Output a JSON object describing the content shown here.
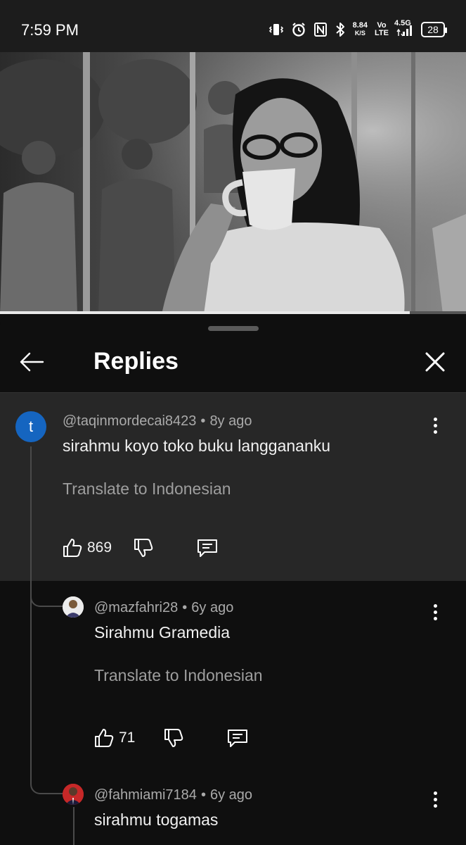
{
  "status_bar": {
    "time": "7:59 PM",
    "net_speed_value": "8.84",
    "net_speed_unit": "K/S",
    "volte_top": "Vo",
    "volte_bottom": "LTE",
    "network": "4.5G",
    "battery": "28"
  },
  "video": {
    "progress_fraction": 0.88
  },
  "header": {
    "title": "Replies"
  },
  "parent_comment": {
    "avatar_letter": "t",
    "handle": "@taqinmordecai8423",
    "time": "8y ago",
    "text": "sirahmu koyo toko buku langgananku",
    "translate": "Translate to Indonesian",
    "likes": "869"
  },
  "replies": [
    {
      "handle": "@mazfahri28",
      "time": "6y ago",
      "text": "Sirahmu Gramedia",
      "translate": "Translate to Indonesian",
      "likes": "71"
    },
    {
      "handle": "@fahmiami7184",
      "time": "6y ago",
      "text": "sirahmu togamas"
    }
  ],
  "meta_separator": "•",
  "colors": {
    "sheet_bg": "#0f0f0f",
    "highlight_bg": "#272727",
    "avatar_t": "#1565c0",
    "muted_text": "#aaaaaa"
  }
}
